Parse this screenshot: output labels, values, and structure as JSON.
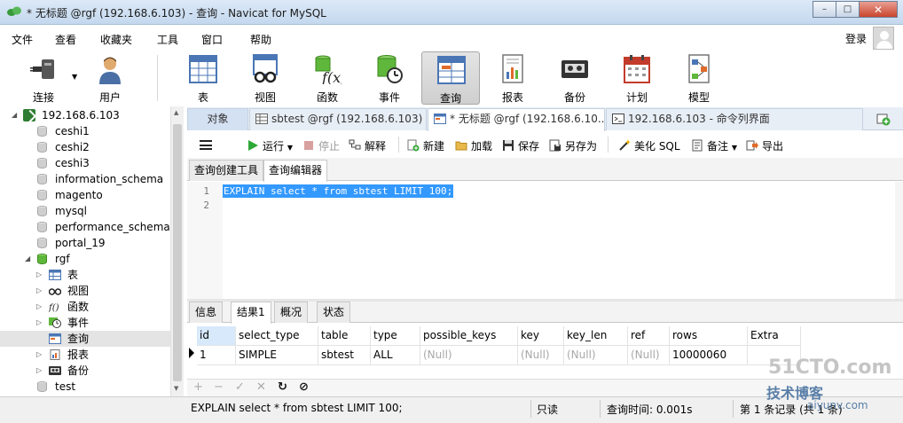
{
  "window": {
    "title": "* 无标题 @rgf (192.168.6.103) - 查询 - Navicat for MySQL",
    "controls": {
      "minimize": "–",
      "maximize": "□",
      "close": "✕"
    }
  },
  "menu": {
    "items": [
      "文件",
      "查看",
      "收藏夹",
      "工具",
      "窗口",
      "帮助"
    ],
    "login": "登录"
  },
  "toolbar": {
    "buttons": [
      "连接",
      "用户",
      "表",
      "视图",
      "函数",
      "事件",
      "查询",
      "报表",
      "备份",
      "计划",
      "模型"
    ]
  },
  "sidebar": {
    "connection": "192.168.6.103",
    "databases": [
      "ceshi1",
      "ceshi2",
      "ceshi3",
      "information_schema",
      "magento",
      "mysql",
      "performance_schema",
      "portal_19",
      "rgf"
    ],
    "rgf_children": [
      "表",
      "视图",
      "函数",
      "事件",
      "查询",
      "报表",
      "备份"
    ],
    "last_db": "test"
  },
  "tabs": {
    "objects": "对象",
    "tab1": "sbtest @rgf (192.168.6.103) ...",
    "tab2": "* 无标题 @rgf (192.168.6.10...",
    "tab3": "192.168.6.103 - 命令列界面"
  },
  "query_toolbar": {
    "run": "运行",
    "stop": "停止",
    "explain": "解释",
    "new": "新建",
    "load": "加载",
    "save": "保存",
    "save_as": "另存为",
    "beautify": "美化 SQL",
    "comment": "备注",
    "export": "导出"
  },
  "sub_tabs": {
    "builder": "查询创建工具",
    "editor": "查询编辑器"
  },
  "editor": {
    "line_numbers": [
      "1",
      "2"
    ],
    "code": "EXPLAIN select * from sbtest LIMIT 100;"
  },
  "result_tabs": [
    "信息",
    "结果1",
    "概况",
    "状态"
  ],
  "grid": {
    "columns": [
      "id",
      "select_type",
      "table",
      "type",
      "possible_keys",
      "key",
      "key_len",
      "ref",
      "rows",
      "Extra"
    ],
    "rows": [
      [
        "1",
        "SIMPLE",
        "sbtest",
        "ALL",
        "(Null)",
        "(Null)",
        "(Null)",
        "(Null)",
        "10000060",
        ""
      ]
    ]
  },
  "grid_nav": [
    "+",
    "−",
    "✓",
    "✕",
    "↻",
    "⊘"
  ],
  "status": {
    "sql": "EXPLAIN select * from sbtest LIMIT 100;",
    "readonly": "只读",
    "query_time": "查询时间: 0.001s",
    "record": "第 1 条记录 (共 1 条)"
  },
  "watermark": {
    "line1": "51CTO.com",
    "line2": "技术博客",
    "line3": "aiyunv.com"
  }
}
